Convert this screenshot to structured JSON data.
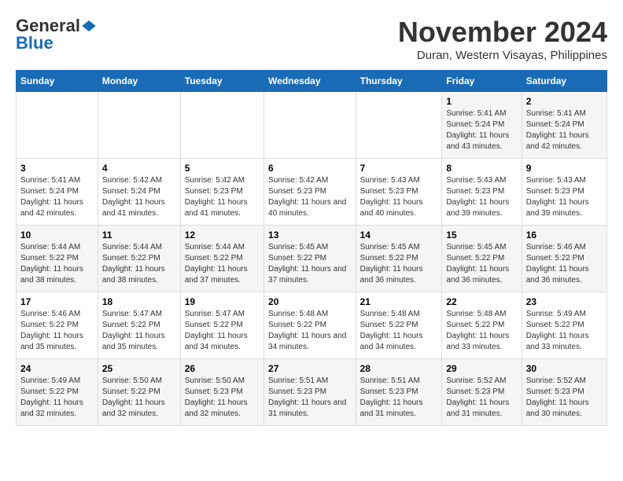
{
  "logo": {
    "line1": "General",
    "line2": "Blue"
  },
  "title": "November 2024",
  "subtitle": "Duran, Western Visayas, Philippines",
  "days_of_week": [
    "Sunday",
    "Monday",
    "Tuesday",
    "Wednesday",
    "Thursday",
    "Friday",
    "Saturday"
  ],
  "weeks": [
    [
      {
        "day": "",
        "info": ""
      },
      {
        "day": "",
        "info": ""
      },
      {
        "day": "",
        "info": ""
      },
      {
        "day": "",
        "info": ""
      },
      {
        "day": "",
        "info": ""
      },
      {
        "day": "1",
        "info": "Sunrise: 5:41 AM\nSunset: 5:24 PM\nDaylight: 11 hours and 43 minutes."
      },
      {
        "day": "2",
        "info": "Sunrise: 5:41 AM\nSunset: 5:24 PM\nDaylight: 11 hours and 42 minutes."
      }
    ],
    [
      {
        "day": "3",
        "info": "Sunrise: 5:41 AM\nSunset: 5:24 PM\nDaylight: 11 hours and 42 minutes."
      },
      {
        "day": "4",
        "info": "Sunrise: 5:42 AM\nSunset: 5:24 PM\nDaylight: 11 hours and 41 minutes."
      },
      {
        "day": "5",
        "info": "Sunrise: 5:42 AM\nSunset: 5:23 PM\nDaylight: 11 hours and 41 minutes."
      },
      {
        "day": "6",
        "info": "Sunrise: 5:42 AM\nSunset: 5:23 PM\nDaylight: 11 hours and 40 minutes."
      },
      {
        "day": "7",
        "info": "Sunrise: 5:43 AM\nSunset: 5:23 PM\nDaylight: 11 hours and 40 minutes."
      },
      {
        "day": "8",
        "info": "Sunrise: 5:43 AM\nSunset: 5:23 PM\nDaylight: 11 hours and 39 minutes."
      },
      {
        "day": "9",
        "info": "Sunrise: 5:43 AM\nSunset: 5:23 PM\nDaylight: 11 hours and 39 minutes."
      }
    ],
    [
      {
        "day": "10",
        "info": "Sunrise: 5:44 AM\nSunset: 5:22 PM\nDaylight: 11 hours and 38 minutes."
      },
      {
        "day": "11",
        "info": "Sunrise: 5:44 AM\nSunset: 5:22 PM\nDaylight: 11 hours and 38 minutes."
      },
      {
        "day": "12",
        "info": "Sunrise: 5:44 AM\nSunset: 5:22 PM\nDaylight: 11 hours and 37 minutes."
      },
      {
        "day": "13",
        "info": "Sunrise: 5:45 AM\nSunset: 5:22 PM\nDaylight: 11 hours and 37 minutes."
      },
      {
        "day": "14",
        "info": "Sunrise: 5:45 AM\nSunset: 5:22 PM\nDaylight: 11 hours and 36 minutes."
      },
      {
        "day": "15",
        "info": "Sunrise: 5:45 AM\nSunset: 5:22 PM\nDaylight: 11 hours and 36 minutes."
      },
      {
        "day": "16",
        "info": "Sunrise: 5:46 AM\nSunset: 5:22 PM\nDaylight: 11 hours and 36 minutes."
      }
    ],
    [
      {
        "day": "17",
        "info": "Sunrise: 5:46 AM\nSunset: 5:22 PM\nDaylight: 11 hours and 35 minutes."
      },
      {
        "day": "18",
        "info": "Sunrise: 5:47 AM\nSunset: 5:22 PM\nDaylight: 11 hours and 35 minutes."
      },
      {
        "day": "19",
        "info": "Sunrise: 5:47 AM\nSunset: 5:22 PM\nDaylight: 11 hours and 34 minutes."
      },
      {
        "day": "20",
        "info": "Sunrise: 5:48 AM\nSunset: 5:22 PM\nDaylight: 11 hours and 34 minutes."
      },
      {
        "day": "21",
        "info": "Sunrise: 5:48 AM\nSunset: 5:22 PM\nDaylight: 11 hours and 34 minutes."
      },
      {
        "day": "22",
        "info": "Sunrise: 5:48 AM\nSunset: 5:22 PM\nDaylight: 11 hours and 33 minutes."
      },
      {
        "day": "23",
        "info": "Sunrise: 5:49 AM\nSunset: 5:22 PM\nDaylight: 11 hours and 33 minutes."
      }
    ],
    [
      {
        "day": "24",
        "info": "Sunrise: 5:49 AM\nSunset: 5:22 PM\nDaylight: 11 hours and 32 minutes."
      },
      {
        "day": "25",
        "info": "Sunrise: 5:50 AM\nSunset: 5:22 PM\nDaylight: 11 hours and 32 minutes."
      },
      {
        "day": "26",
        "info": "Sunrise: 5:50 AM\nSunset: 5:23 PM\nDaylight: 11 hours and 32 minutes."
      },
      {
        "day": "27",
        "info": "Sunrise: 5:51 AM\nSunset: 5:23 PM\nDaylight: 11 hours and 31 minutes."
      },
      {
        "day": "28",
        "info": "Sunrise: 5:51 AM\nSunset: 5:23 PM\nDaylight: 11 hours and 31 minutes."
      },
      {
        "day": "29",
        "info": "Sunrise: 5:52 AM\nSunset: 5:23 PM\nDaylight: 11 hours and 31 minutes."
      },
      {
        "day": "30",
        "info": "Sunrise: 5:52 AM\nSunset: 5:23 PM\nDaylight: 11 hours and 30 minutes."
      }
    ]
  ]
}
